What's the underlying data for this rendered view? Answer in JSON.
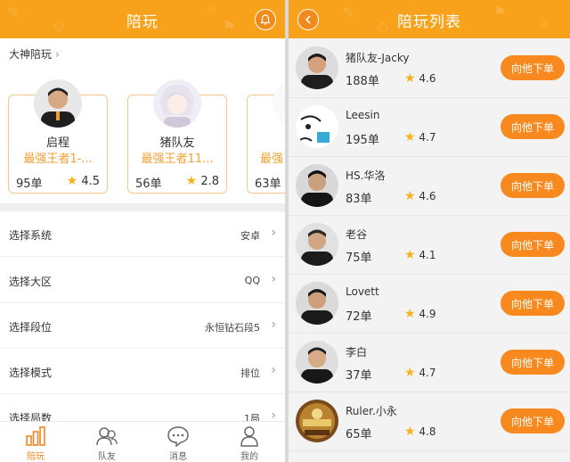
{
  "left": {
    "header": {
      "title": "陪玩"
    },
    "section_title": "大神陪玩",
    "cards": [
      {
        "name": "启程",
        "rank": "最强王者1-...",
        "orders": "95单",
        "rating": "4.5"
      },
      {
        "name": "猪队友",
        "rank": "最强王者11...",
        "orders": "56单",
        "rating": "2.8"
      },
      {
        "name": "",
        "rank": "最强",
        "orders": "63单",
        "rating": ""
      }
    ],
    "options": [
      {
        "label": "选择系统",
        "value": "安卓"
      },
      {
        "label": "选择大区",
        "value": "QQ"
      },
      {
        "label": "选择段位",
        "value": "永恒钻石段5"
      },
      {
        "label": "选择模式",
        "value": "排位"
      },
      {
        "label": "选择局数",
        "value": "1局"
      }
    ],
    "tabs": [
      {
        "label": "陪玩",
        "icon": "bar-chart-icon"
      },
      {
        "label": "队友",
        "icon": "friends-icon"
      },
      {
        "label": "消息",
        "icon": "chat-bubble-icon"
      },
      {
        "label": "我的",
        "icon": "person-icon"
      }
    ]
  },
  "right": {
    "header": {
      "title": "陪玩列表"
    },
    "order_button_label": "向他下单",
    "players": [
      {
        "name": "猪队友-Jacky",
        "orders": "188单",
        "rating": "4.6"
      },
      {
        "name": "Leesin",
        "orders": "195单",
        "rating": "4.7"
      },
      {
        "name": "HS.华洛",
        "orders": "83单",
        "rating": "4.6"
      },
      {
        "name": "老谷",
        "orders": "75单",
        "rating": "4.1"
      },
      {
        "name": "Lovett",
        "orders": "72单",
        "rating": "4.9"
      },
      {
        "name": "李白",
        "orders": "37单",
        "rating": "4.7"
      },
      {
        "name": "Ruler.小永",
        "orders": "65单",
        "rating": "4.8"
      }
    ]
  },
  "colors": {
    "accent": "#f7a21a",
    "button": "#f7891f",
    "rank_text": "#f0a032",
    "star": "#f5b21c"
  }
}
